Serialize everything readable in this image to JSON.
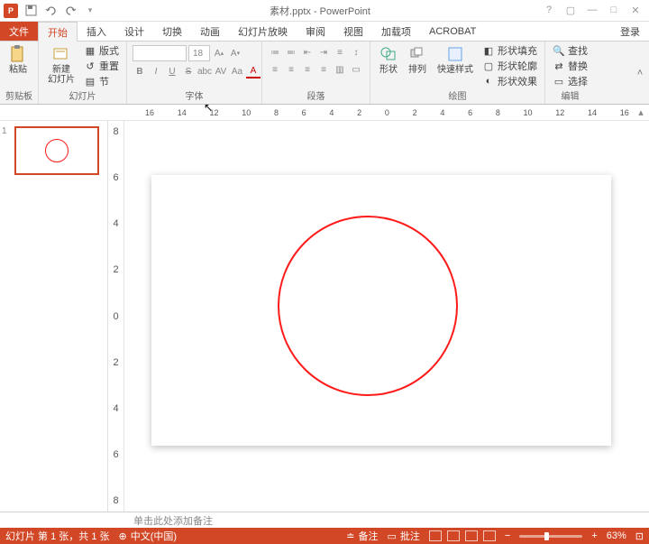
{
  "titlebar": {
    "title": "素材.pptx - PowerPoint"
  },
  "win": {
    "help": "?",
    "ribbon": "▢",
    "min": "—",
    "max": "□",
    "close": "✕"
  },
  "tabs": {
    "file": "文件",
    "home": "开始",
    "insert": "插入",
    "design": "设计",
    "trans": "切换",
    "anim": "动画",
    "show": "幻灯片放映",
    "review": "审阅",
    "view": "视图",
    "addins": "加载项",
    "acrobat": "ACROBAT",
    "login": "登录"
  },
  "ribbon": {
    "clipboard": {
      "label": "剪贴板",
      "paste": "粘贴"
    },
    "slides": {
      "label": "幻灯片",
      "new": "新建\n幻灯片",
      "layout": "版式",
      "reset": "重置",
      "section": "节"
    },
    "font": {
      "label": "字体",
      "size": "18",
      "bold": "B",
      "italic": "I",
      "underline": "U",
      "strike": "S",
      "abc": "abc",
      "av": "AV",
      "aa": "Aa",
      "color": "A"
    },
    "paragraph": {
      "label": "段落"
    },
    "drawing": {
      "label": "绘图",
      "shapes": "形状",
      "arrange": "排列",
      "quick": "快速样式",
      "fill": "形状填充",
      "outline": "形状轮廓",
      "effects": "形状效果"
    },
    "editing": {
      "label": "编辑",
      "find": "查找",
      "replace": "替换",
      "select": "选择"
    }
  },
  "rulerH": [
    "16",
    "14",
    "12",
    "10",
    "8",
    "6",
    "4",
    "2",
    "0",
    "2",
    "4",
    "6",
    "8",
    "10",
    "12",
    "14",
    "16"
  ],
  "rulerV": [
    "8",
    "6",
    "4",
    "2",
    "0",
    "2",
    "4",
    "6",
    "8"
  ],
  "thumb": {
    "num": "1"
  },
  "notes": {
    "placeholder": "单击此处添加备注"
  },
  "status": {
    "slide": "幻灯片 第 1 张，共 1 张",
    "lang": "中文(中国)",
    "notes": "备注",
    "comments": "批注",
    "zoom": "63%"
  }
}
